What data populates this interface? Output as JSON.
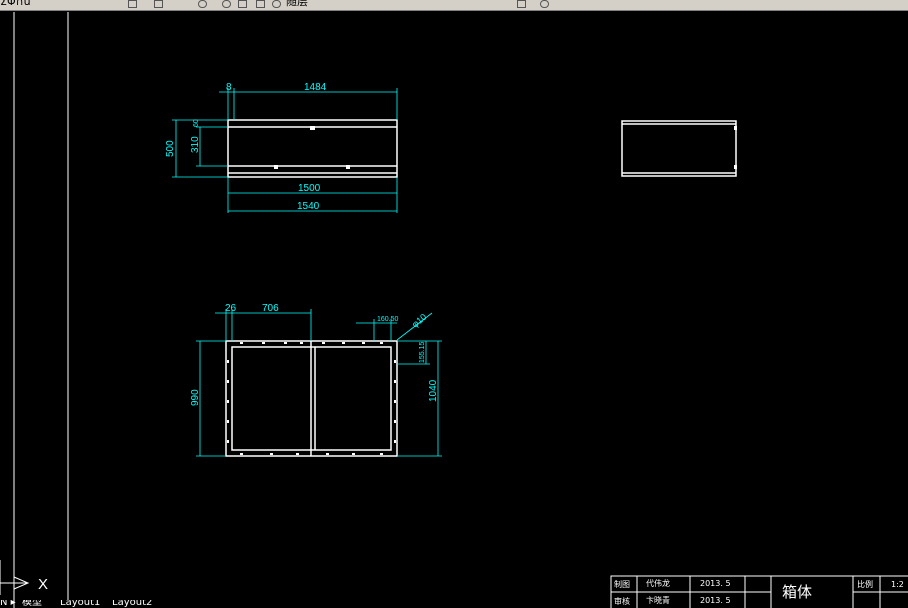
{
  "toolbar": {
    "layer_label": "ΣΦ∩ü",
    "layer_state_label": "随层"
  },
  "drawing": {
    "side_view": {
      "dim_top_small": "8",
      "dim_top": "1484",
      "dim_left_outer": "500",
      "dim_left_inner": "310",
      "dim_left_tiny": "60",
      "dim_bottom_inner": "1500",
      "dim_bottom_outer": "1540"
    },
    "top_view": {
      "dim_small": "26",
      "dim_span": "706",
      "dim_hole_spacing": "160.50",
      "dim_hole_dia": "φ10",
      "dim_hole_offset": "155.15",
      "dim_left": "990",
      "dim_right": "1040"
    }
  },
  "ucs": {
    "x_label": "X"
  },
  "layout_tabs": [
    "模型",
    "Layout1",
    "Layout2"
  ],
  "title_block": {
    "drawn_label": "制图",
    "drawn_name": "代伟龙",
    "drawn_date": "2013. 5",
    "checked_label": "审核",
    "checked_name": "卞晓青",
    "checked_date": "2013. 5",
    "part_name": "箱体",
    "scale_label": "比例",
    "scale_value": "1:2"
  },
  "colors": {
    "background": "#000000",
    "geometry": "#ffffff",
    "dimension": "#00ffff"
  }
}
